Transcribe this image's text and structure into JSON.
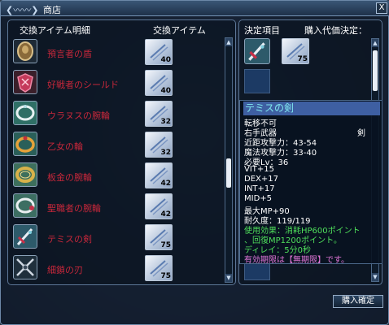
{
  "window": {
    "title": "商店",
    "close_label": "X"
  },
  "left_panel": {
    "header_item": "交換アイテム明細",
    "header_trade": "交換アイテム",
    "items": [
      {
        "name": "預言者の盾",
        "icon": "shield-icon",
        "qty": "40"
      },
      {
        "name": "好戦者のシールド",
        "icon": "battle-shield-icon",
        "qty": "40"
      },
      {
        "name": "ウラヌスの腕輪",
        "icon": "bracelet-icon",
        "qty": "32"
      },
      {
        "name": "乙女の輪",
        "icon": "ring-icon",
        "qty": "32"
      },
      {
        "name": "板金の腕輪",
        "icon": "bracelet-icon",
        "qty": "42"
      },
      {
        "name": "聖職者の腕輪",
        "icon": "bracelet-icon",
        "qty": "42"
      },
      {
        "name": "テミスの剣",
        "icon": "sword-icon",
        "qty": "75"
      },
      {
        "name": "細鎖の刃",
        "icon": "blade-icon",
        "qty": "75"
      }
    ]
  },
  "right_panel": {
    "header_selected": "決定項目",
    "header_price": "購入代価決定：",
    "price_qty": "75"
  },
  "tooltip": {
    "title": "テミスの剣",
    "type": "剣",
    "lines": [
      "転移不可",
      "右手武器",
      "近距攻撃力：43-54",
      "魔法攻撃力：33-40",
      "必要Lv：36",
      "VIT+15",
      "DEX+17",
      "INT+17",
      "MID+5",
      "最大MP+90",
      "耐久度：119/119"
    ],
    "effect_lines": [
      "使用効果：消耗HP600ポイント",
      "、回復MP1200ポイント。",
      "ディレイ：5分0秒"
    ],
    "expiry_line": "有効期限は【無期限】です。"
  },
  "footer": {
    "buy_label": "購入確定"
  },
  "colors": {
    "item_name": "#c4273a",
    "tooltip_title_bg": "#3e5fa2",
    "effect_text": "#4fdf5b",
    "expiry_text": "#e276d8"
  }
}
